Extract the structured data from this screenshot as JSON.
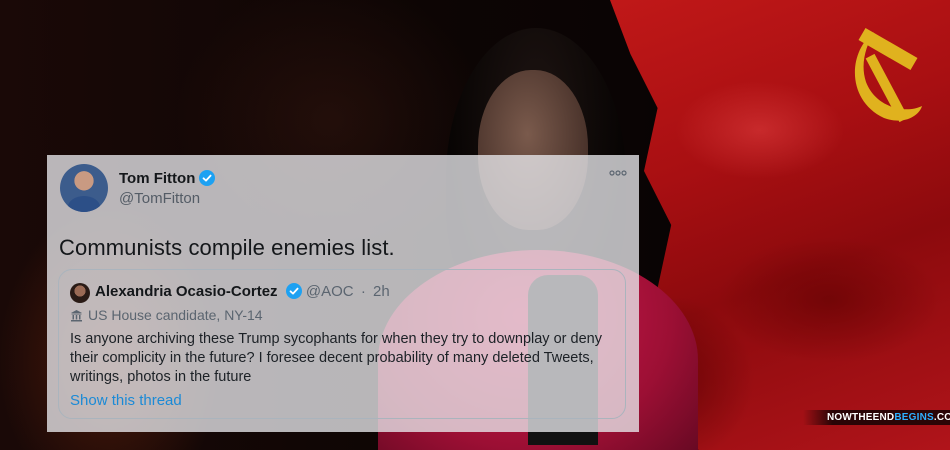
{
  "tweet": {
    "author_name": "Tom Fitton",
    "author_handle": "@TomFitton",
    "text": "Communists compile enemies list.",
    "quoted": {
      "author_name": "Alexandria Ocasio-Cortez",
      "author_handle": "@AOC",
      "separator": "·",
      "time": "2h",
      "label": "US House candidate, NY-14",
      "text": "Is anyone archiving these Trump sycophants for when they try to downplay or deny their complicity in the future? I foresee decent probability of many deleted Tweets, writings, photos in the future",
      "link": "Show this thread"
    }
  },
  "watermark": {
    "part1": "NOWTHEEND",
    "part2": "BEGINS",
    "part3": ".COM"
  },
  "icons": {
    "verified": "verified-badge-icon",
    "more": "more-options-icon",
    "label": "government-building-icon",
    "flag_symbol": "hammer-and-sickle-icon"
  },
  "colors": {
    "verified_blue": "#1da1f2",
    "link_blue": "#1b8ad6",
    "flag_red": "#b0141a",
    "jacket_red": "#c8184a"
  }
}
